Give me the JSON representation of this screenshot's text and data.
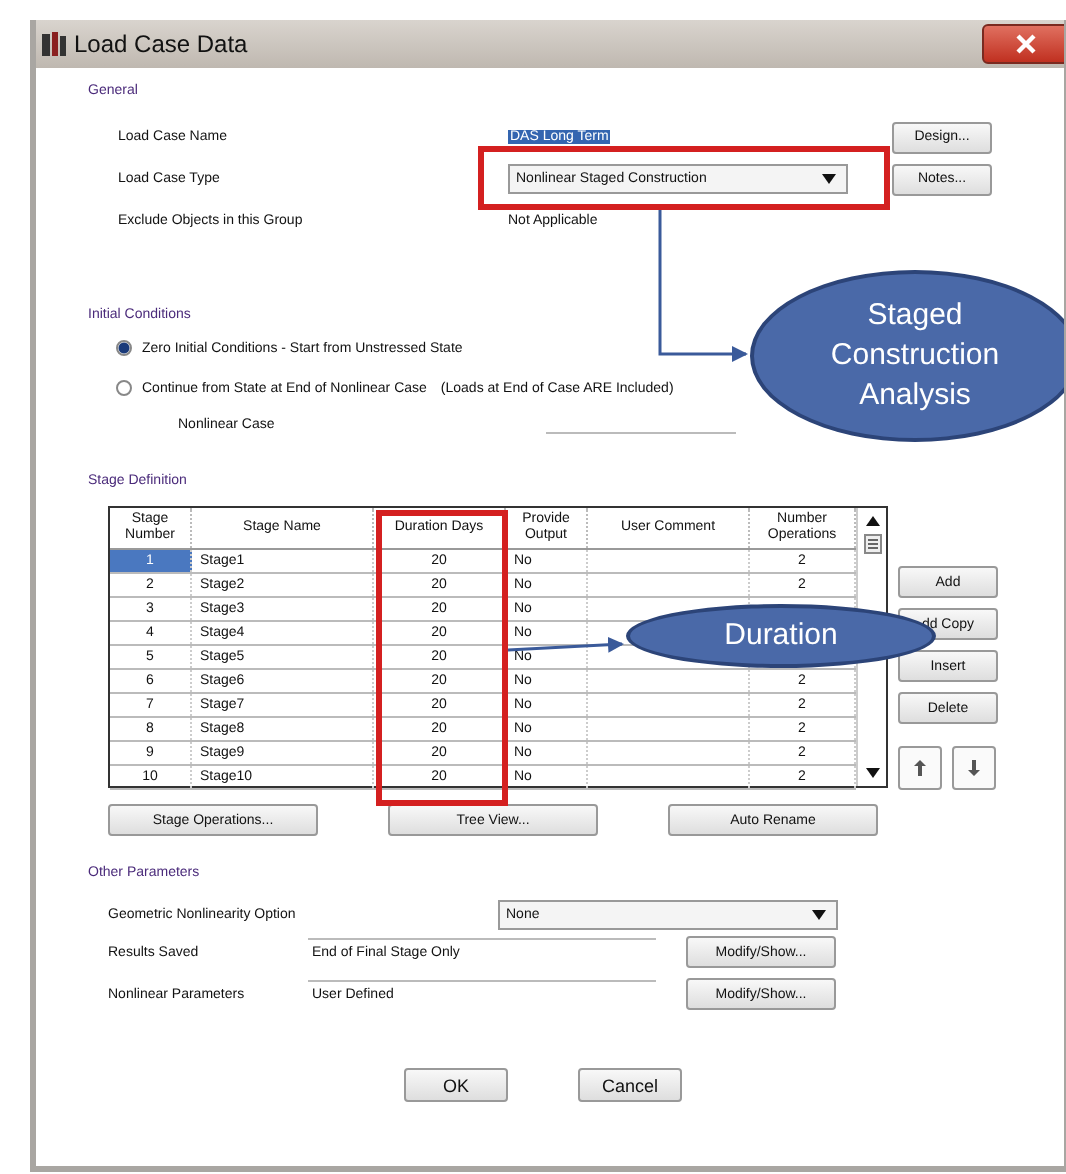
{
  "window": {
    "title": "Load Case Data"
  },
  "general": {
    "heading": "General",
    "fields": [
      {
        "kind": "text",
        "label": "Load Case Name",
        "value": "DAS Long Term",
        "highlighted": true,
        "button": "Design..."
      },
      {
        "kind": "dropdown",
        "label": "Load Case Type",
        "value": "Nonlinear Staged Construction",
        "button": "Notes..."
      },
      {
        "kind": "static",
        "label": "Exclude Objects in this Group",
        "value": "Not Applicable"
      }
    ]
  },
  "initial_conditions": {
    "heading": "Initial Conditions",
    "options": [
      {
        "label": "Zero Initial Conditions - Start from Unstressed State",
        "selected": true
      },
      {
        "label": "Continue from State at End of Nonlinear Case",
        "note": "(Loads at End of Case ARE Included)",
        "selected": false
      }
    ],
    "nonlinear_case": {
      "label": "Nonlinear Case"
    }
  },
  "stage_definition": {
    "heading": "Stage Definition",
    "table": {
      "columns": [
        "Stage Number",
        "Stage Name",
        "Duration Days",
        "Provide Output",
        "User Comment",
        "Number Operations"
      ],
      "rows": [
        {
          "number": "1",
          "name": "Stage1",
          "duration": "20",
          "output": "No",
          "operations": "2",
          "selected": true
        },
        {
          "number": "2",
          "name": "Stage2",
          "duration": "20",
          "output": "No",
          "operations": "2",
          "selected": false
        },
        {
          "number": "3",
          "name": "Stage3",
          "duration": "20",
          "output": "No",
          "selected": false
        },
        {
          "number": "4",
          "name": "Stage4",
          "duration": "20",
          "output": "No",
          "selected": false
        },
        {
          "number": "5",
          "name": "Stage5",
          "duration": "20",
          "output": "No",
          "selected": false
        },
        {
          "number": "6",
          "name": "Stage6",
          "duration": "20",
          "output": "No",
          "operations": "2",
          "selected": false
        },
        {
          "number": "7",
          "name": "Stage7",
          "duration": "20",
          "output": "No",
          "operations": "2",
          "selected": false
        },
        {
          "number": "8",
          "name": "Stage8",
          "duration": "20",
          "output": "No",
          "operations": "2",
          "selected": false
        },
        {
          "number": "9",
          "name": "Stage9",
          "duration": "20",
          "output": "No",
          "operations": "2",
          "selected": false
        },
        {
          "number": "10",
          "name": "Stage10",
          "duration": "20",
          "output": "No",
          "operations": "2",
          "selected": false
        }
      ]
    },
    "side_buttons": [
      "Add",
      "dd Copy",
      "Insert",
      "Delete"
    ],
    "buttons": [
      "Stage Operations...",
      "Tree View...",
      "Auto Rename"
    ]
  },
  "other_parameters": {
    "heading": "Other Parameters",
    "geometric": {
      "label": "Geometric Nonlinearity Option",
      "value": "None"
    },
    "fields": [
      {
        "label": "Results Saved",
        "value": "End of Final Stage Only",
        "button": "Modify/Show..."
      },
      {
        "label": "Nonlinear Parameters",
        "value": "User Defined",
        "button": "Modify/Show..."
      }
    ]
  },
  "footer_buttons": [
    "OK",
    "Cancel"
  ],
  "callouts": [
    {
      "kind": "staged",
      "text": "Staged Construction Analysis"
    },
    {
      "kind": "duration",
      "text": "Duration"
    }
  ]
}
